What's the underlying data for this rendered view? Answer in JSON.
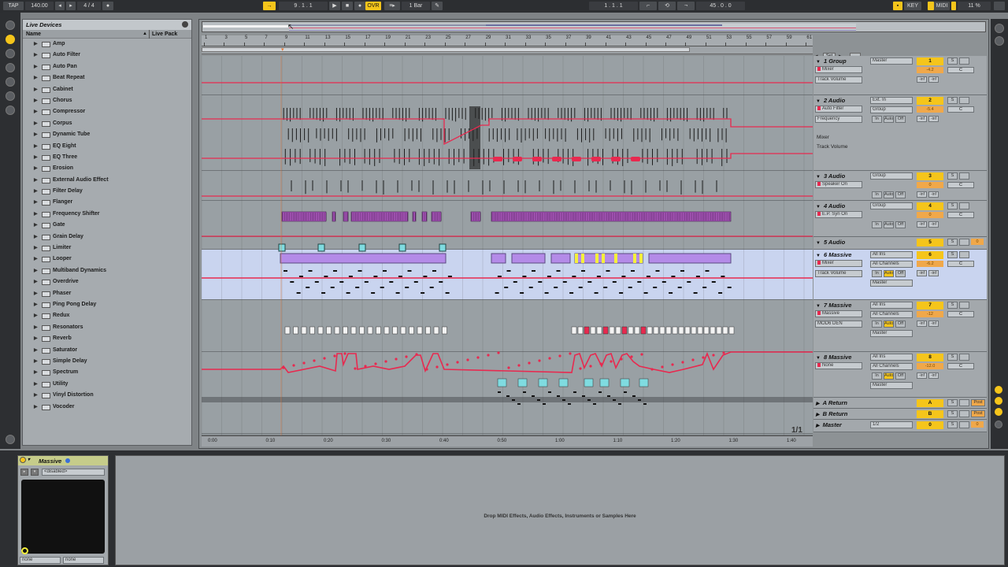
{
  "transport": {
    "tap": "TAP",
    "tempo": "140.00",
    "sig": "4 / 4",
    "position": "9 . 1 . 1",
    "ovr": "OVR",
    "quantize": "1 Bar",
    "loop_start": "1 . 1 . 1",
    "loop_length": "45 . 0 . 0",
    "key": "KEY",
    "midi": "MIDI",
    "cpu": "11 %"
  },
  "browser": {
    "title": "Live Devices",
    "col_name": "Name",
    "col_pack": "Live Pack",
    "items": [
      "Amp",
      "Auto Filter",
      "Auto Pan",
      "Beat Repeat",
      "Cabinet",
      "Chorus",
      "Compressor",
      "Corpus",
      "Dynamic Tube",
      "EQ Eight",
      "EQ Three",
      "Erosion",
      "External Audio Effect",
      "Filter Delay",
      "Flanger",
      "Frequency Shifter",
      "Gate",
      "Grain Delay",
      "Limiter",
      "Looper",
      "Multiband Dynamics",
      "Overdrive",
      "Phaser",
      "Ping Pong Delay",
      "Redux",
      "Resonators",
      "Reverb",
      "Saturator",
      "Simple Delay",
      "Spectrum",
      "Utility",
      "Vinyl Distortion",
      "Vocoder"
    ]
  },
  "ruler": {
    "bars": [
      "1",
      "3",
      "5",
      "7",
      "9",
      "11",
      "13",
      "15",
      "17",
      "19",
      "21",
      "23",
      "25",
      "27",
      "29",
      "31",
      "33",
      "35",
      "37",
      "39",
      "41",
      "43",
      "45",
      "47",
      "49",
      "51",
      "53",
      "55",
      "57",
      "59",
      "61"
    ],
    "times": [
      "0:00",
      "0:10",
      "0:20",
      "0:30",
      "0:40",
      "0:50",
      "1:00",
      "1:10",
      "1:20",
      "1:30",
      "1:40"
    ],
    "page": "1/1"
  },
  "tracks": [
    {
      "name": "1 Group",
      "chooser": "Mixer",
      "param": "Track Volume",
      "io": "Master",
      "number": "1",
      "meter": "-4.2",
      "pan": "C"
    },
    {
      "name": "2 Audio",
      "chooser": "Auto Filter",
      "param": "Frequency",
      "io": "Ext. In",
      "io2": "Group",
      "number": "2",
      "meter": "-5.4",
      "pan": "C",
      "sub1": "Mixer",
      "sub2": "Track Volume"
    },
    {
      "name": "3 Audio",
      "chooser": "Speaker On",
      "io": "Group",
      "number": "3",
      "meter": "0",
      "pan": "C"
    },
    {
      "name": "4 Audio",
      "chooser": "E.P. Syn On",
      "io": "Group",
      "number": "4",
      "meter": "0",
      "pan": "C"
    },
    {
      "name": "5 Audio",
      "number": "5",
      "meter": "0",
      "pan": "C"
    },
    {
      "name": "6 Massive",
      "chooser": "Mixer",
      "param": "Track Volume",
      "io": "All Ins",
      "io2": "All Channels",
      "io3": "Master",
      "number": "6",
      "meter": "-6.2",
      "pan": "C"
    },
    {
      "name": "7 Massive",
      "chooser": "Massive",
      "param": "MOD6 DEN",
      "io": "All Ins",
      "io2": "All Channels",
      "io3": "Master",
      "number": "7",
      "meter": "-12",
      "pan": "C"
    },
    {
      "name": "8 Massive",
      "chooser": "None",
      "io": "All Ins",
      "io2": "All Channels",
      "io3": "Master",
      "number": "8",
      "meter": "-12.0",
      "pan": "C"
    },
    {
      "name": "A Return",
      "number": "A",
      "meter": "0",
      "pan": "C",
      "post": "Post"
    },
    {
      "name": "B Return",
      "number": "B",
      "meter": "0",
      "pan": "C",
      "post": "Post"
    },
    {
      "name": "Master",
      "io": "1/2",
      "number": "0",
      "meter": "0",
      "pan": "C"
    }
  ],
  "labels": {
    "inf": "-inf",
    "in": "In",
    "auto": "Auto",
    "off": "Off",
    "solo": "S",
    "set": "Set"
  },
  "device": {
    "name": "Massive",
    "preset": "<disabled>",
    "in": "none",
    "out": "none"
  },
  "dropzone": "Drop MIDI Effects, Audio Effects, Instruments or Samples Here",
  "colors": {
    "accent": "#f5c51b",
    "automation": "#e8294f",
    "selected_track": "#c9d4ef",
    "clip_purple": "#b48be8",
    "clip_cyan": "#7fdbe0"
  }
}
